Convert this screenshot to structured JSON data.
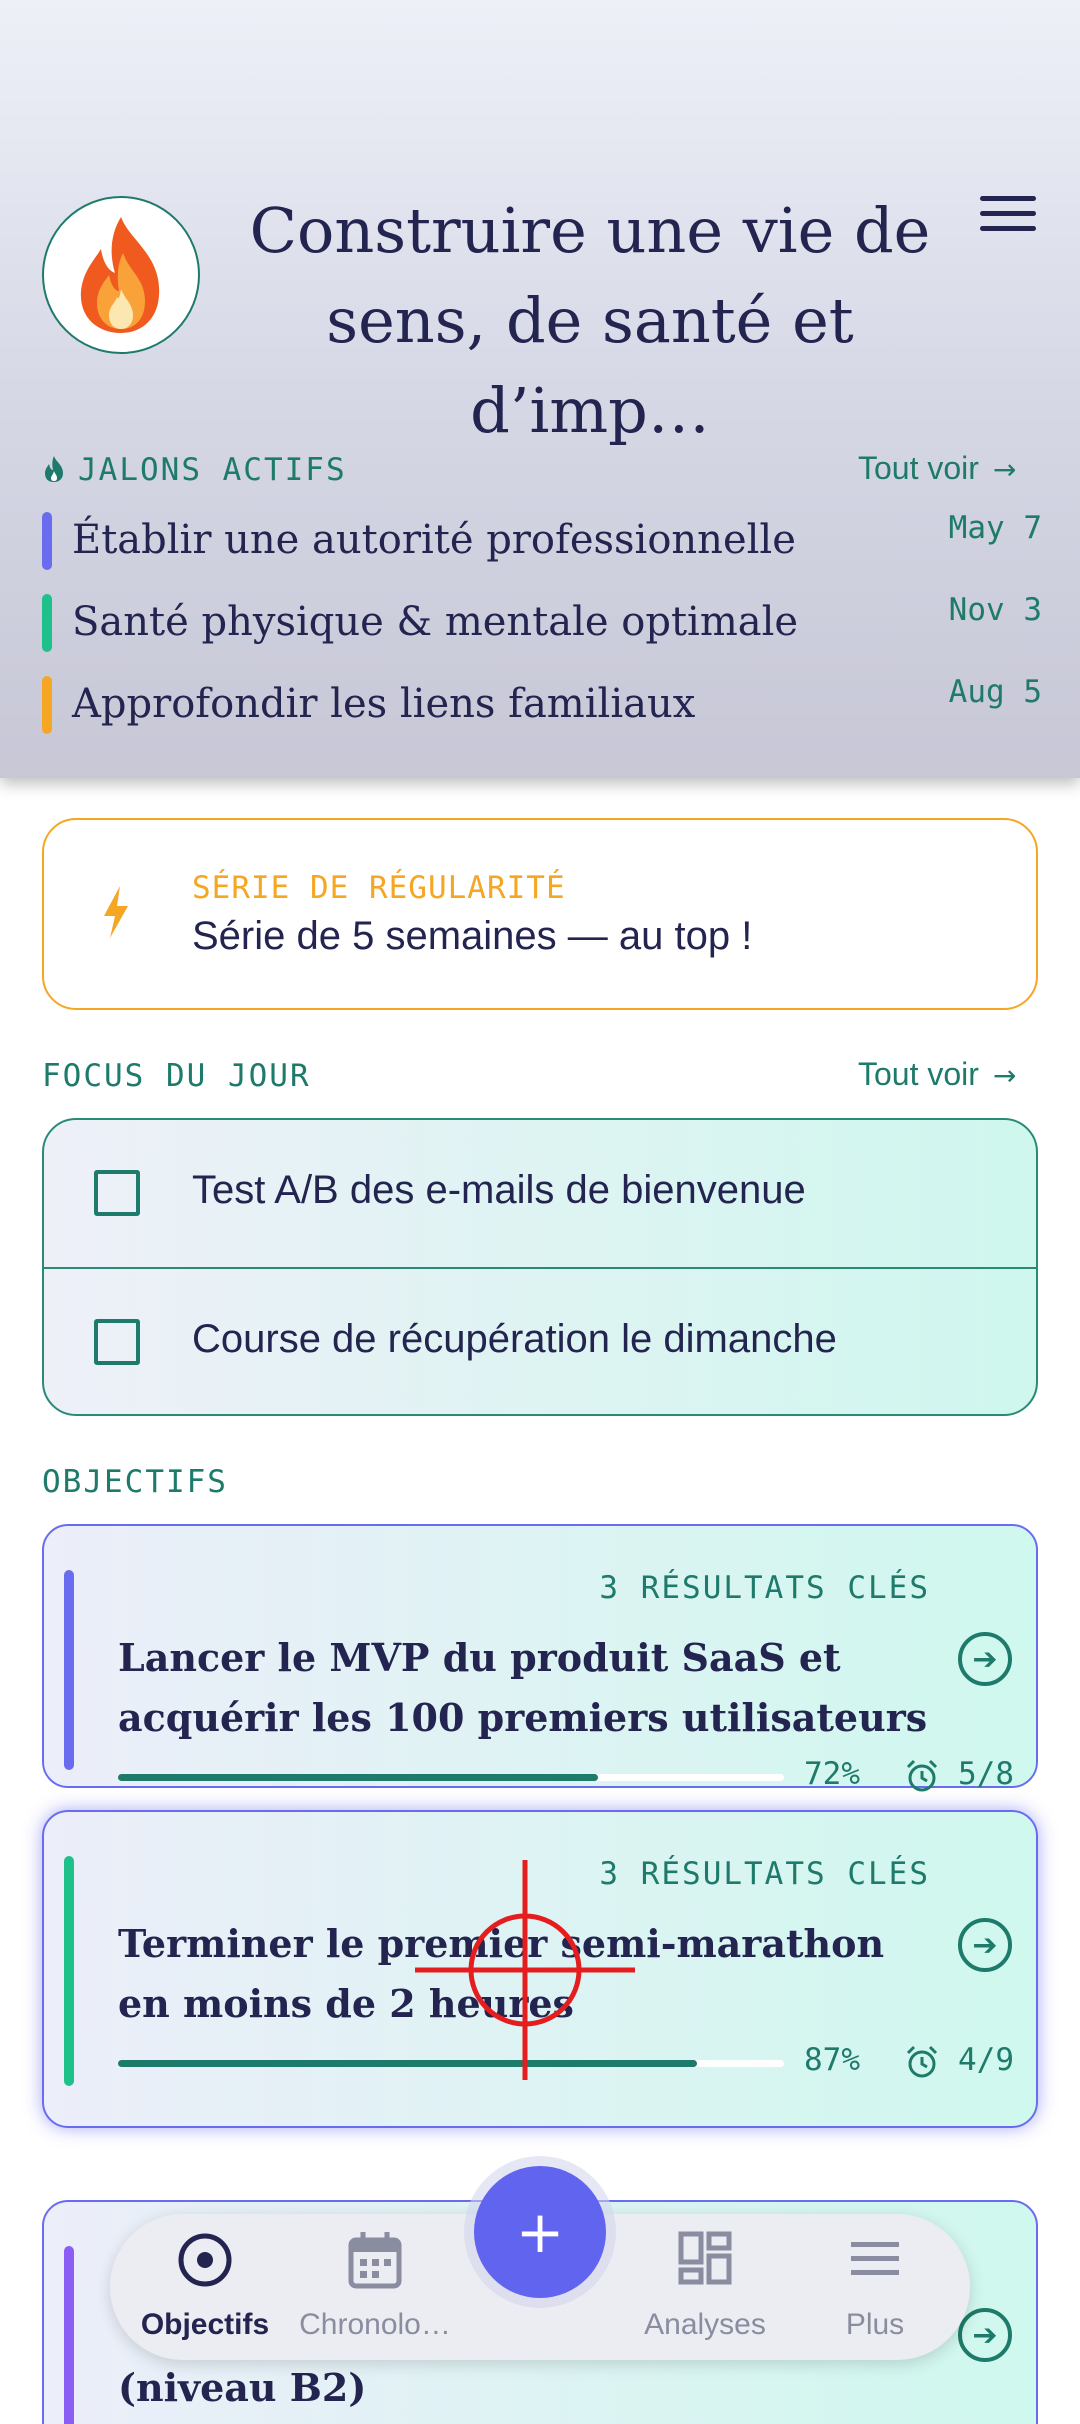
{
  "header": {
    "title": "Construire une vie de sens, de santé et d’imp…",
    "logo_icon": "fire-icon",
    "menu_icon": "hamburger-menu-icon"
  },
  "milestones": {
    "label": "JALONS ACTIFS",
    "see_all": "Tout voir",
    "items": [
      {
        "name": "Établir une autorité professionnelle",
        "date": "May 7",
        "color": "#6a6cf0"
      },
      {
        "name": "Santé physique & mentale optimale",
        "date": "Nov 3",
        "color": "#1fc18a"
      },
      {
        "name": "Approfondir les liens familiaux",
        "date": "Aug 5",
        "color": "#f5a623"
      }
    ]
  },
  "streak": {
    "label": "SÉRIE DE RÉGULARITÉ",
    "message": "Série de 5 semaines — au top !",
    "color": "#f5a623"
  },
  "focus": {
    "label": "FOCUS DU JOUR",
    "see_all": "Tout voir",
    "tasks": [
      {
        "text": "Test A/B des e-mails de bienvenue",
        "checked": false
      },
      {
        "text": "Course de récupération le dimanche",
        "checked": false
      }
    ]
  },
  "objectives": {
    "label": "OBJECTIFS",
    "items": [
      {
        "key_results": "3 RÉSULTATS CLÉS",
        "title": "Lancer le MVP du produit SaaS et acquérir les 100 premiers utilisateurs",
        "progress_label": "72%",
        "progress": 0.72,
        "count": "5/8",
        "color": "#6a6cf0"
      },
      {
        "key_results": "3 RÉSULTATS CLÉS",
        "title": "Terminer le premier semi-marathon en moins de 2 heures",
        "progress_label": "87%",
        "progress": 0.87,
        "count": "4/9",
        "color": "#1fc18a"
      },
      {
        "title_partial": "(niveau B2)",
        "color": "#8b5cf6"
      }
    ]
  },
  "nav": {
    "items": [
      {
        "label": "Objectifs",
        "icon": "target-icon",
        "active": true
      },
      {
        "label": "Chronolo…",
        "icon": "calendar-icon",
        "active": false
      },
      {
        "label": "Analyses",
        "icon": "dashboard-icon",
        "active": false
      },
      {
        "label": "Plus",
        "icon": "menu-icon",
        "active": false
      }
    ],
    "fab": "+",
    "fab_color": "#6164ee"
  },
  "brand_color": "#1e7a6a"
}
